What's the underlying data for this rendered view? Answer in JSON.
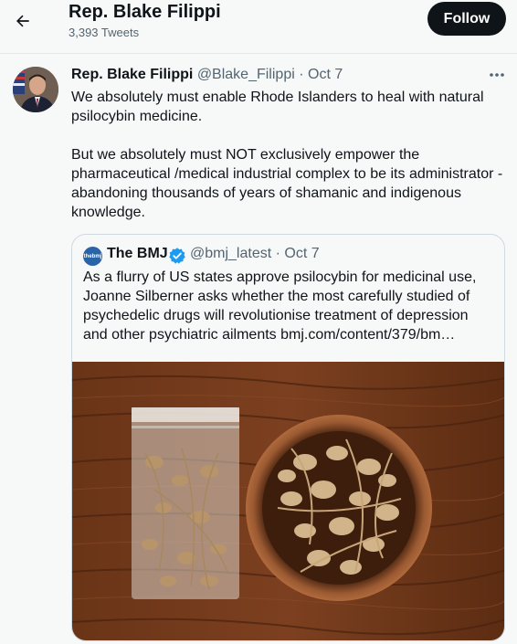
{
  "header": {
    "title": "Rep. Blake Filippi",
    "tweet_count": "3,393 Tweets",
    "follow_label": "Follow"
  },
  "tweet": {
    "author_name": "Rep. Blake Filippi",
    "handle": "@Blake_Filippi",
    "separator": "·",
    "date": "Oct 7",
    "paragraph_1": "We absolutely must enable Rhode Islanders to heal with natural psilocybin medicine.",
    "paragraph_2": "But we absolutely must NOT exclusively empower the pharmaceutical /medical industrial complex to be its administrator - abandoning thousands of years of shamanic and indigenous knowledge."
  },
  "quote": {
    "avatar_text": "thebmj",
    "author_name": "The BMJ",
    "handle": "@bmj_latest",
    "separator": "·",
    "date": "Oct 7",
    "text": "As a flurry of US states approve psilocybin for medicinal use, Joanne Silberner asks whether the most carefully studied of psychedelic drugs will revolutionise treatment of depression and other psychiatric ailments bmj.com/content/379/bm…"
  },
  "icons": {
    "back": "arrow-left-icon",
    "more": "more-horizontal-icon",
    "verified": "verified-badge-icon"
  },
  "colors": {
    "background": "#f7f9f9",
    "text": "#0f1419",
    "secondary_text": "#536471",
    "follow_button": "#0f1419",
    "verified_blue": "#1d9bf0",
    "border": "#cfd9de"
  }
}
